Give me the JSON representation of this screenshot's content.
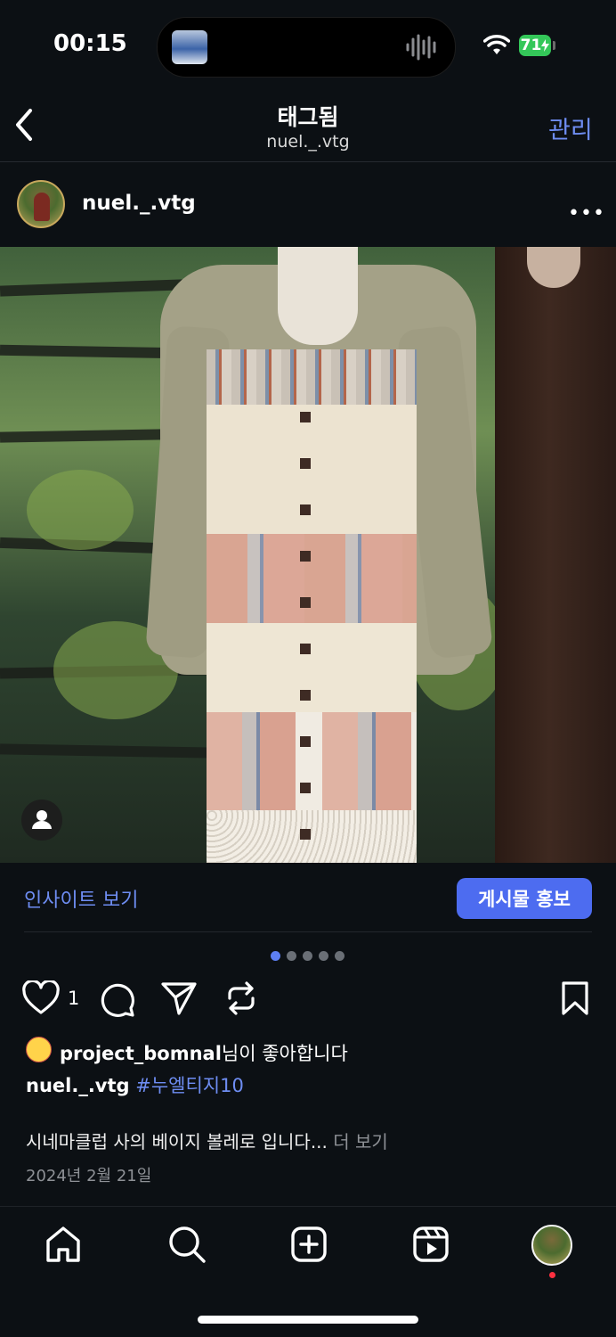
{
  "status_bar": {
    "time": "00:15",
    "battery": "71",
    "wifi_icon": "wifi-icon",
    "charging_icon": "bolt-icon"
  },
  "header": {
    "title": "태그됨",
    "subtitle": "nuel._.vtg",
    "manage_label": "관리",
    "back_icon": "chevron-left-icon"
  },
  "post": {
    "username": "nuel._.vtg",
    "more_icon": "ellipsis-icon",
    "insight_label": "인사이트 보기",
    "promote_label": "게시물 홍보",
    "carousel": {
      "total": 5,
      "active": 1
    },
    "like_count": "1",
    "liked_by_user": "project_bomnal",
    "liked_by_suffix": "님이 좋아합니다",
    "caption_user": "nuel._.vtg",
    "hashtag": "#누엘티지10",
    "description": "시네마클럽 사의 베이지 볼레로 입니다...",
    "more_label": "더 보기",
    "date": "2024년 2월 21일"
  },
  "bottom_nav": {
    "items": [
      "home-icon",
      "search-icon",
      "create-icon",
      "reels-icon",
      "profile-avatar"
    ]
  },
  "colors": {
    "background": "#0c1014",
    "accent": "#6e8df2",
    "promote_button": "#4d6cf0",
    "battery": "#34c759",
    "notification": "#ff3040"
  }
}
